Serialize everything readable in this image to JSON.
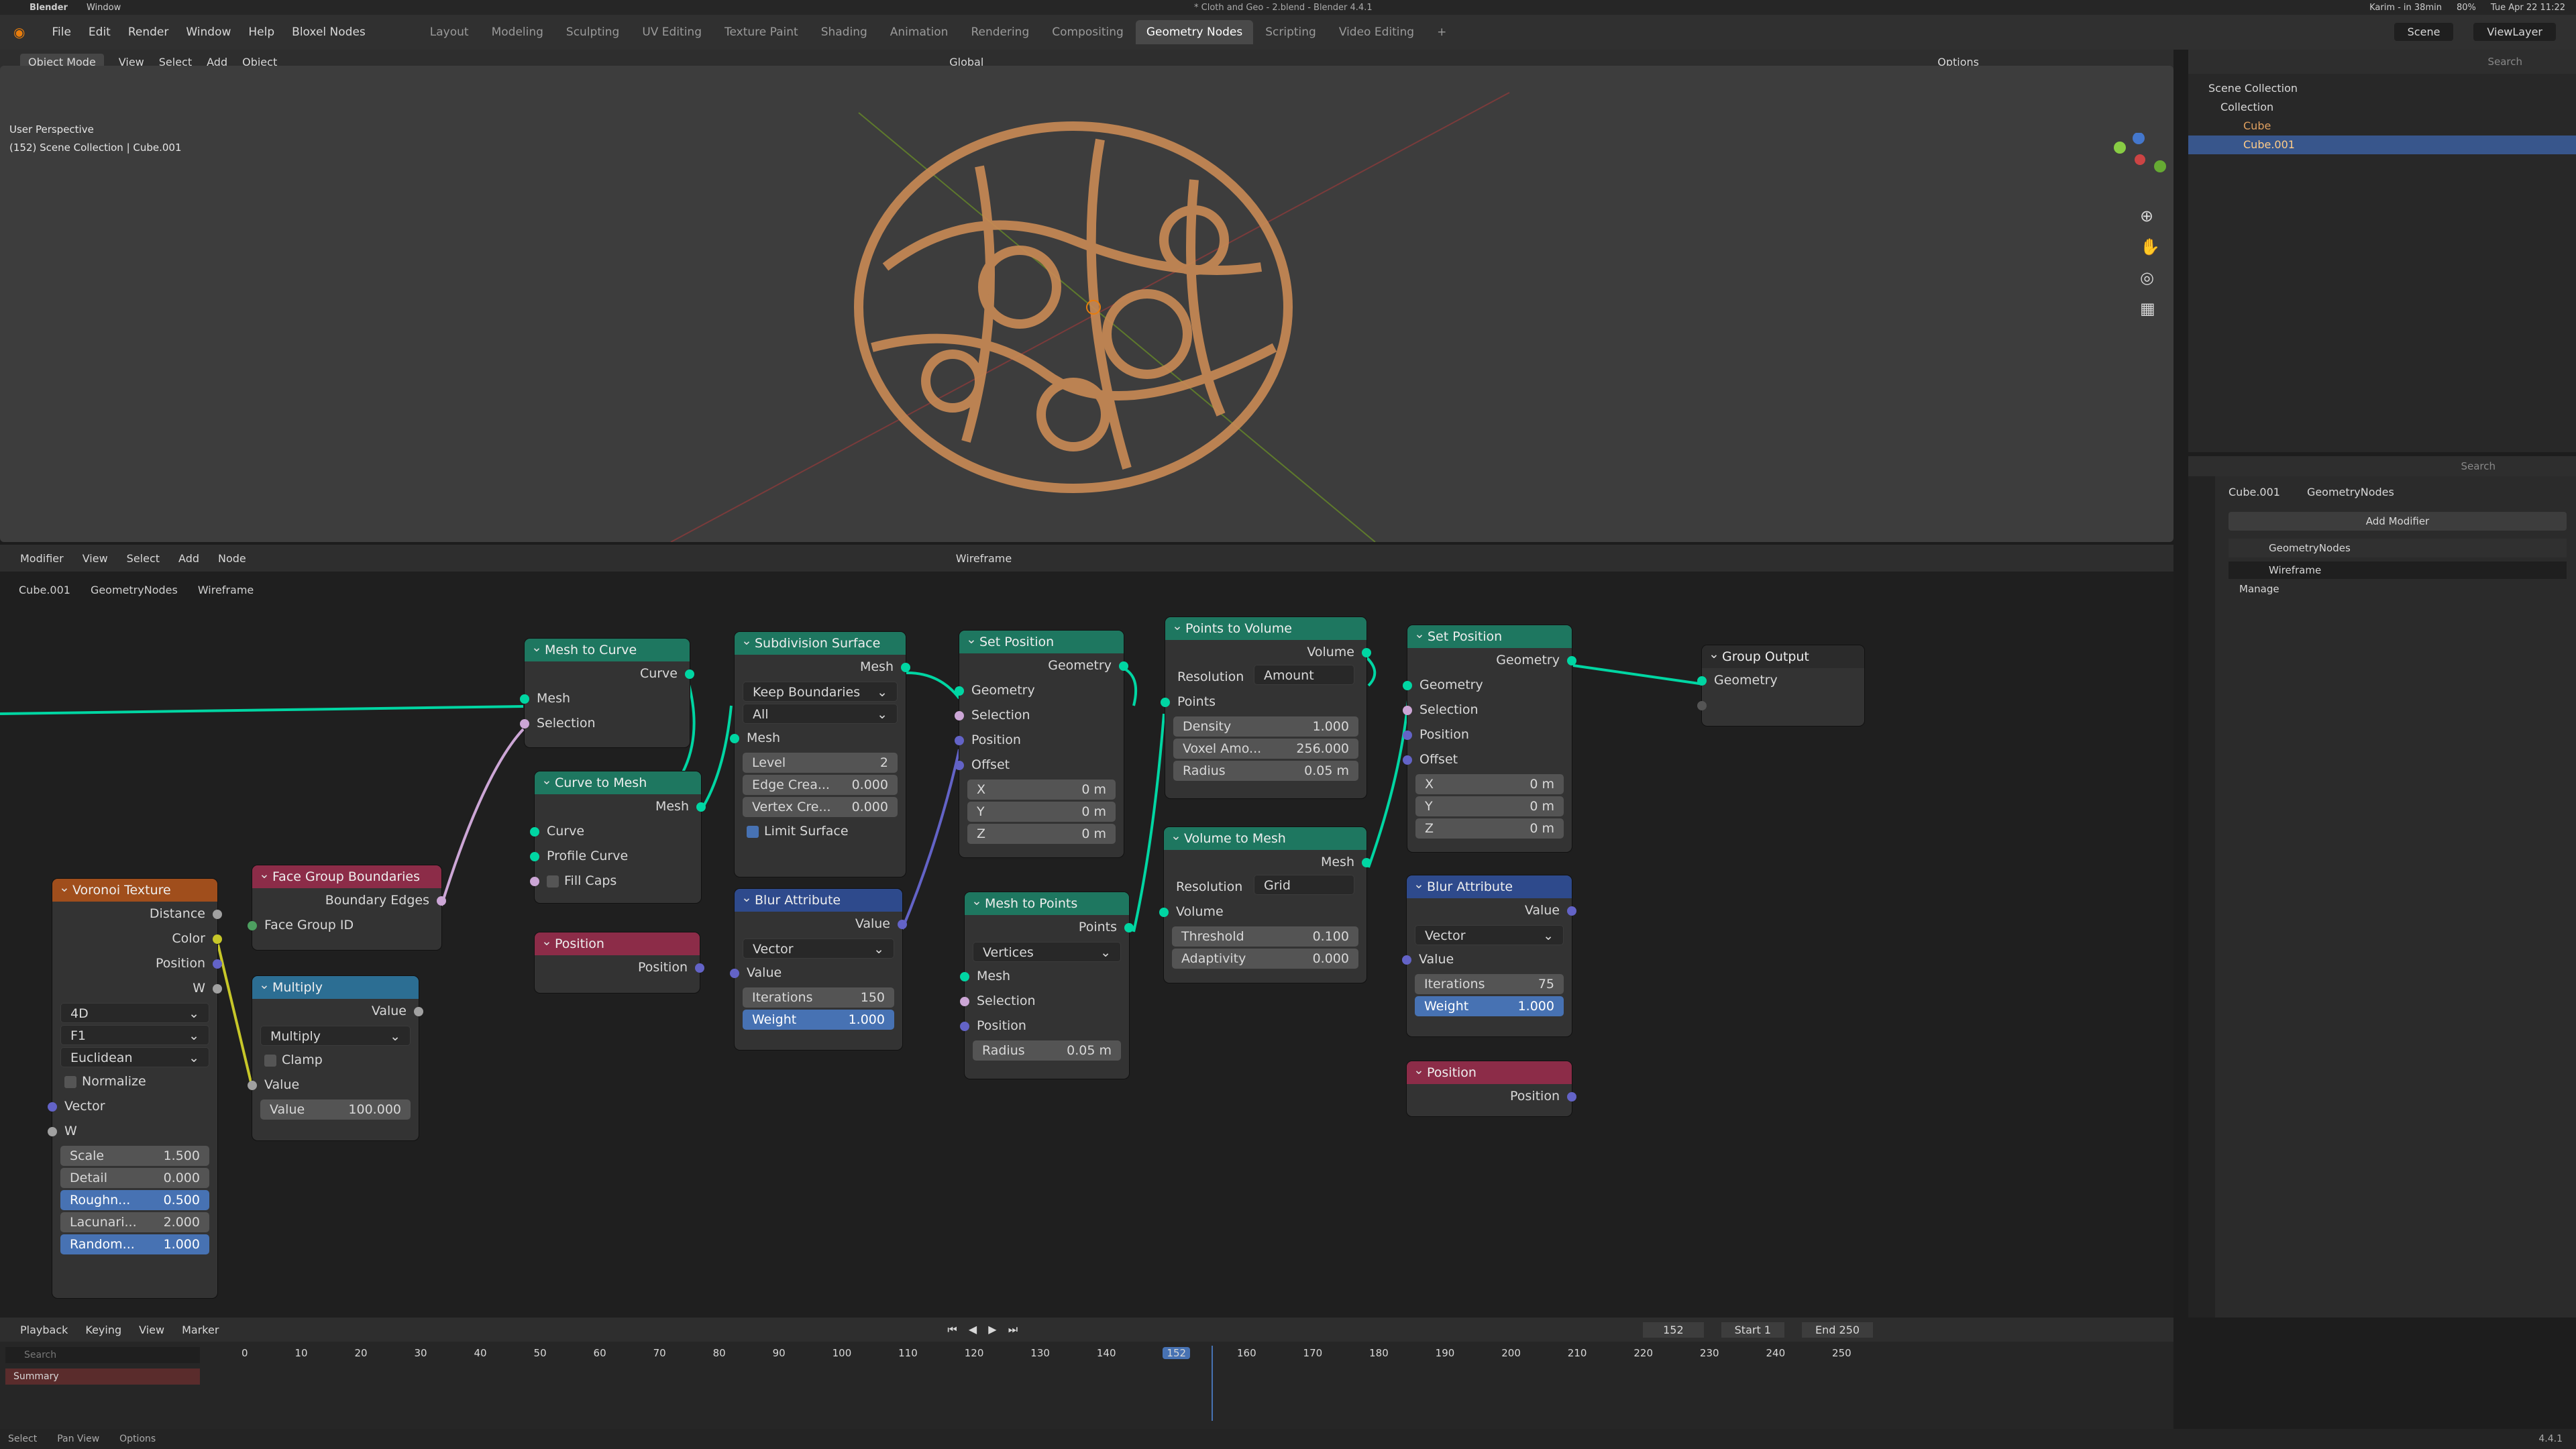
{
  "macbar": {
    "app": "Blender",
    "window": "Window",
    "center": "* Cloth and Geo - 2.blend - Blender 4.4.1",
    "user": "Karim - in 38min",
    "battery": "80%",
    "date": "Tue Apr 22 11:22"
  },
  "menu": [
    "File",
    "Edit",
    "Render",
    "Window",
    "Help",
    "Bloxel Nodes"
  ],
  "workspaces": [
    "Layout",
    "Modeling",
    "Sculpting",
    "UV Editing",
    "Texture Paint",
    "Shading",
    "Animation",
    "Rendering",
    "Compositing",
    "Geometry Nodes",
    "Scripting",
    "Video Editing"
  ],
  "active_workspace": "Geometry Nodes",
  "scene": "Scene",
  "view_layer": "ViewLayer",
  "viewport": {
    "mode": "Object Mode",
    "menus": [
      "View",
      "Select",
      "Add",
      "Object"
    ],
    "orientation": "Global",
    "search_placeholder": "Search",
    "options": "Options",
    "line1": "User Perspective",
    "line2": "(152) Scene Collection | Cube.001"
  },
  "outliner": {
    "search": "Search",
    "items": [
      "Scene Collection",
      "Collection",
      "Cube",
      "Cube.001"
    ]
  },
  "properties": {
    "crumb_obj": "Cube.001",
    "crumb_mod": "GeometryNodes",
    "add_modifier": "Add Modifier",
    "modifier_name": "GeometryNodes",
    "nodegroup": "Wireframe",
    "manage": "Manage",
    "search": "Search"
  },
  "node_editor": {
    "menus": [
      "Modifier",
      "View",
      "Select",
      "Add",
      "Node"
    ],
    "group": "Wireframe",
    "crumbs": [
      "Cube.001",
      "GeometryNodes",
      "Wireframe"
    ]
  },
  "nodes": {
    "mesh_to_curve": {
      "title": "Mesh to Curve",
      "out": "Curve",
      "in1": "Mesh",
      "in2": "Selection"
    },
    "subdiv": {
      "title": "Subdivision Surface",
      "out": "Mesh",
      "dd1": "Keep Boundaries",
      "dd2": "All",
      "in": "Mesh",
      "level_l": "Level",
      "level": "2",
      "edge_l": "Edge Crea...",
      "edge": "0.000",
      "vert_l": "Vertex Cre...",
      "vert": "0.000",
      "limit": "Limit Surface"
    },
    "setpos1": {
      "title": "Set Position",
      "out": "Geometry",
      "in1": "Geometry",
      "in2": "Selection",
      "in3": "Position",
      "in4": "Offset",
      "x": "0 m",
      "y": "0 m",
      "z": "0 m"
    },
    "p2v": {
      "title": "Points to Volume",
      "out": "Volume",
      "res_l": "Resolution",
      "res": "Amount",
      "in": "Points",
      "dens_l": "Density",
      "dens": "1.000",
      "vox_l": "Voxel Amo...",
      "vox": "256.000",
      "rad_l": "Radius",
      "rad": "0.05 m"
    },
    "setpos2": {
      "title": "Set Position",
      "out": "Geometry",
      "in1": "Geometry",
      "in2": "Selection",
      "in3": "Position",
      "in4": "Offset",
      "x": "0 m",
      "y": "0 m",
      "z": "0 m"
    },
    "group_out": {
      "title": "Group Output",
      "in": "Geometry"
    },
    "c2m": {
      "title": "Curve to Mesh",
      "out": "Mesh",
      "in1": "Curve",
      "in2": "Profile Curve",
      "fill": "Fill Caps"
    },
    "fgb": {
      "title": "Face Group Boundaries",
      "out": "Boundary Edges",
      "in": "Face Group ID"
    },
    "voronoi": {
      "title": "Voronoi Texture",
      "o1": "Distance",
      "o2": "Color",
      "o3": "Position",
      "o4": "W",
      "d1": "4D",
      "d2": "F1",
      "d3": "Euclidean",
      "norm": "Normalize",
      "i1": "Vector",
      "i2": "W",
      "scale_l": "Scale",
      "scale": "1.500",
      "detail_l": "Detail",
      "detail": "0.000",
      "rough_l": "Roughn...",
      "rough": "0.500",
      "lac_l": "Lacunari...",
      "lac": "2.000",
      "rand_l": "Random...",
      "rand": "1.000"
    },
    "multiply": {
      "title": "Multiply",
      "out": "Value",
      "op": "Multiply",
      "clamp": "Clamp",
      "in": "Value",
      "v_l": "Value",
      "v": "100.000"
    },
    "pos1": {
      "title": "Position",
      "out": "Position"
    },
    "blur1": {
      "title": "Blur Attribute",
      "out": "Value",
      "type": "Vector",
      "in": "Value",
      "it_l": "Iterations",
      "it": "150",
      "w_l": "Weight",
      "w": "1.000"
    },
    "m2p": {
      "title": "Mesh to Points",
      "out": "Points",
      "mode": "Vertices",
      "i1": "Mesh",
      "i2": "Selection",
      "i3": "Position",
      "r_l": "Radius",
      "r": "0.05 m"
    },
    "v2m": {
      "title": "Volume to Mesh",
      "out": "Mesh",
      "res_l": "Resolution",
      "res": "Grid",
      "in": "Volume",
      "th_l": "Threshold",
      "th": "0.100",
      "ad_l": "Adaptivity",
      "ad": "0.000"
    },
    "blur2": {
      "title": "Blur Attribute",
      "out": "Value",
      "type": "Vector",
      "in": "Value",
      "it_l": "Iterations",
      "it": "75",
      "w_l": "Weight",
      "w": "1.000"
    },
    "pos2": {
      "title": "Position",
      "out": "Position"
    }
  },
  "timeline": {
    "menus": [
      "Playback",
      "Keying",
      "View",
      "Marker"
    ],
    "current": "152",
    "start_l": "Start",
    "start": "1",
    "end_l": "End",
    "end": "250",
    "ticks": [
      "0",
      "10",
      "20",
      "30",
      "40",
      "50",
      "60",
      "70",
      "80",
      "90",
      "100",
      "110",
      "120",
      "130",
      "140",
      "152",
      "160",
      "170",
      "180",
      "190",
      "200",
      "210",
      "220",
      "230",
      "240",
      "250"
    ],
    "summary": "Summary",
    "search": "Search"
  },
  "status": [
    "Select",
    "Pan View",
    "Options"
  ],
  "version": "4.4.1"
}
